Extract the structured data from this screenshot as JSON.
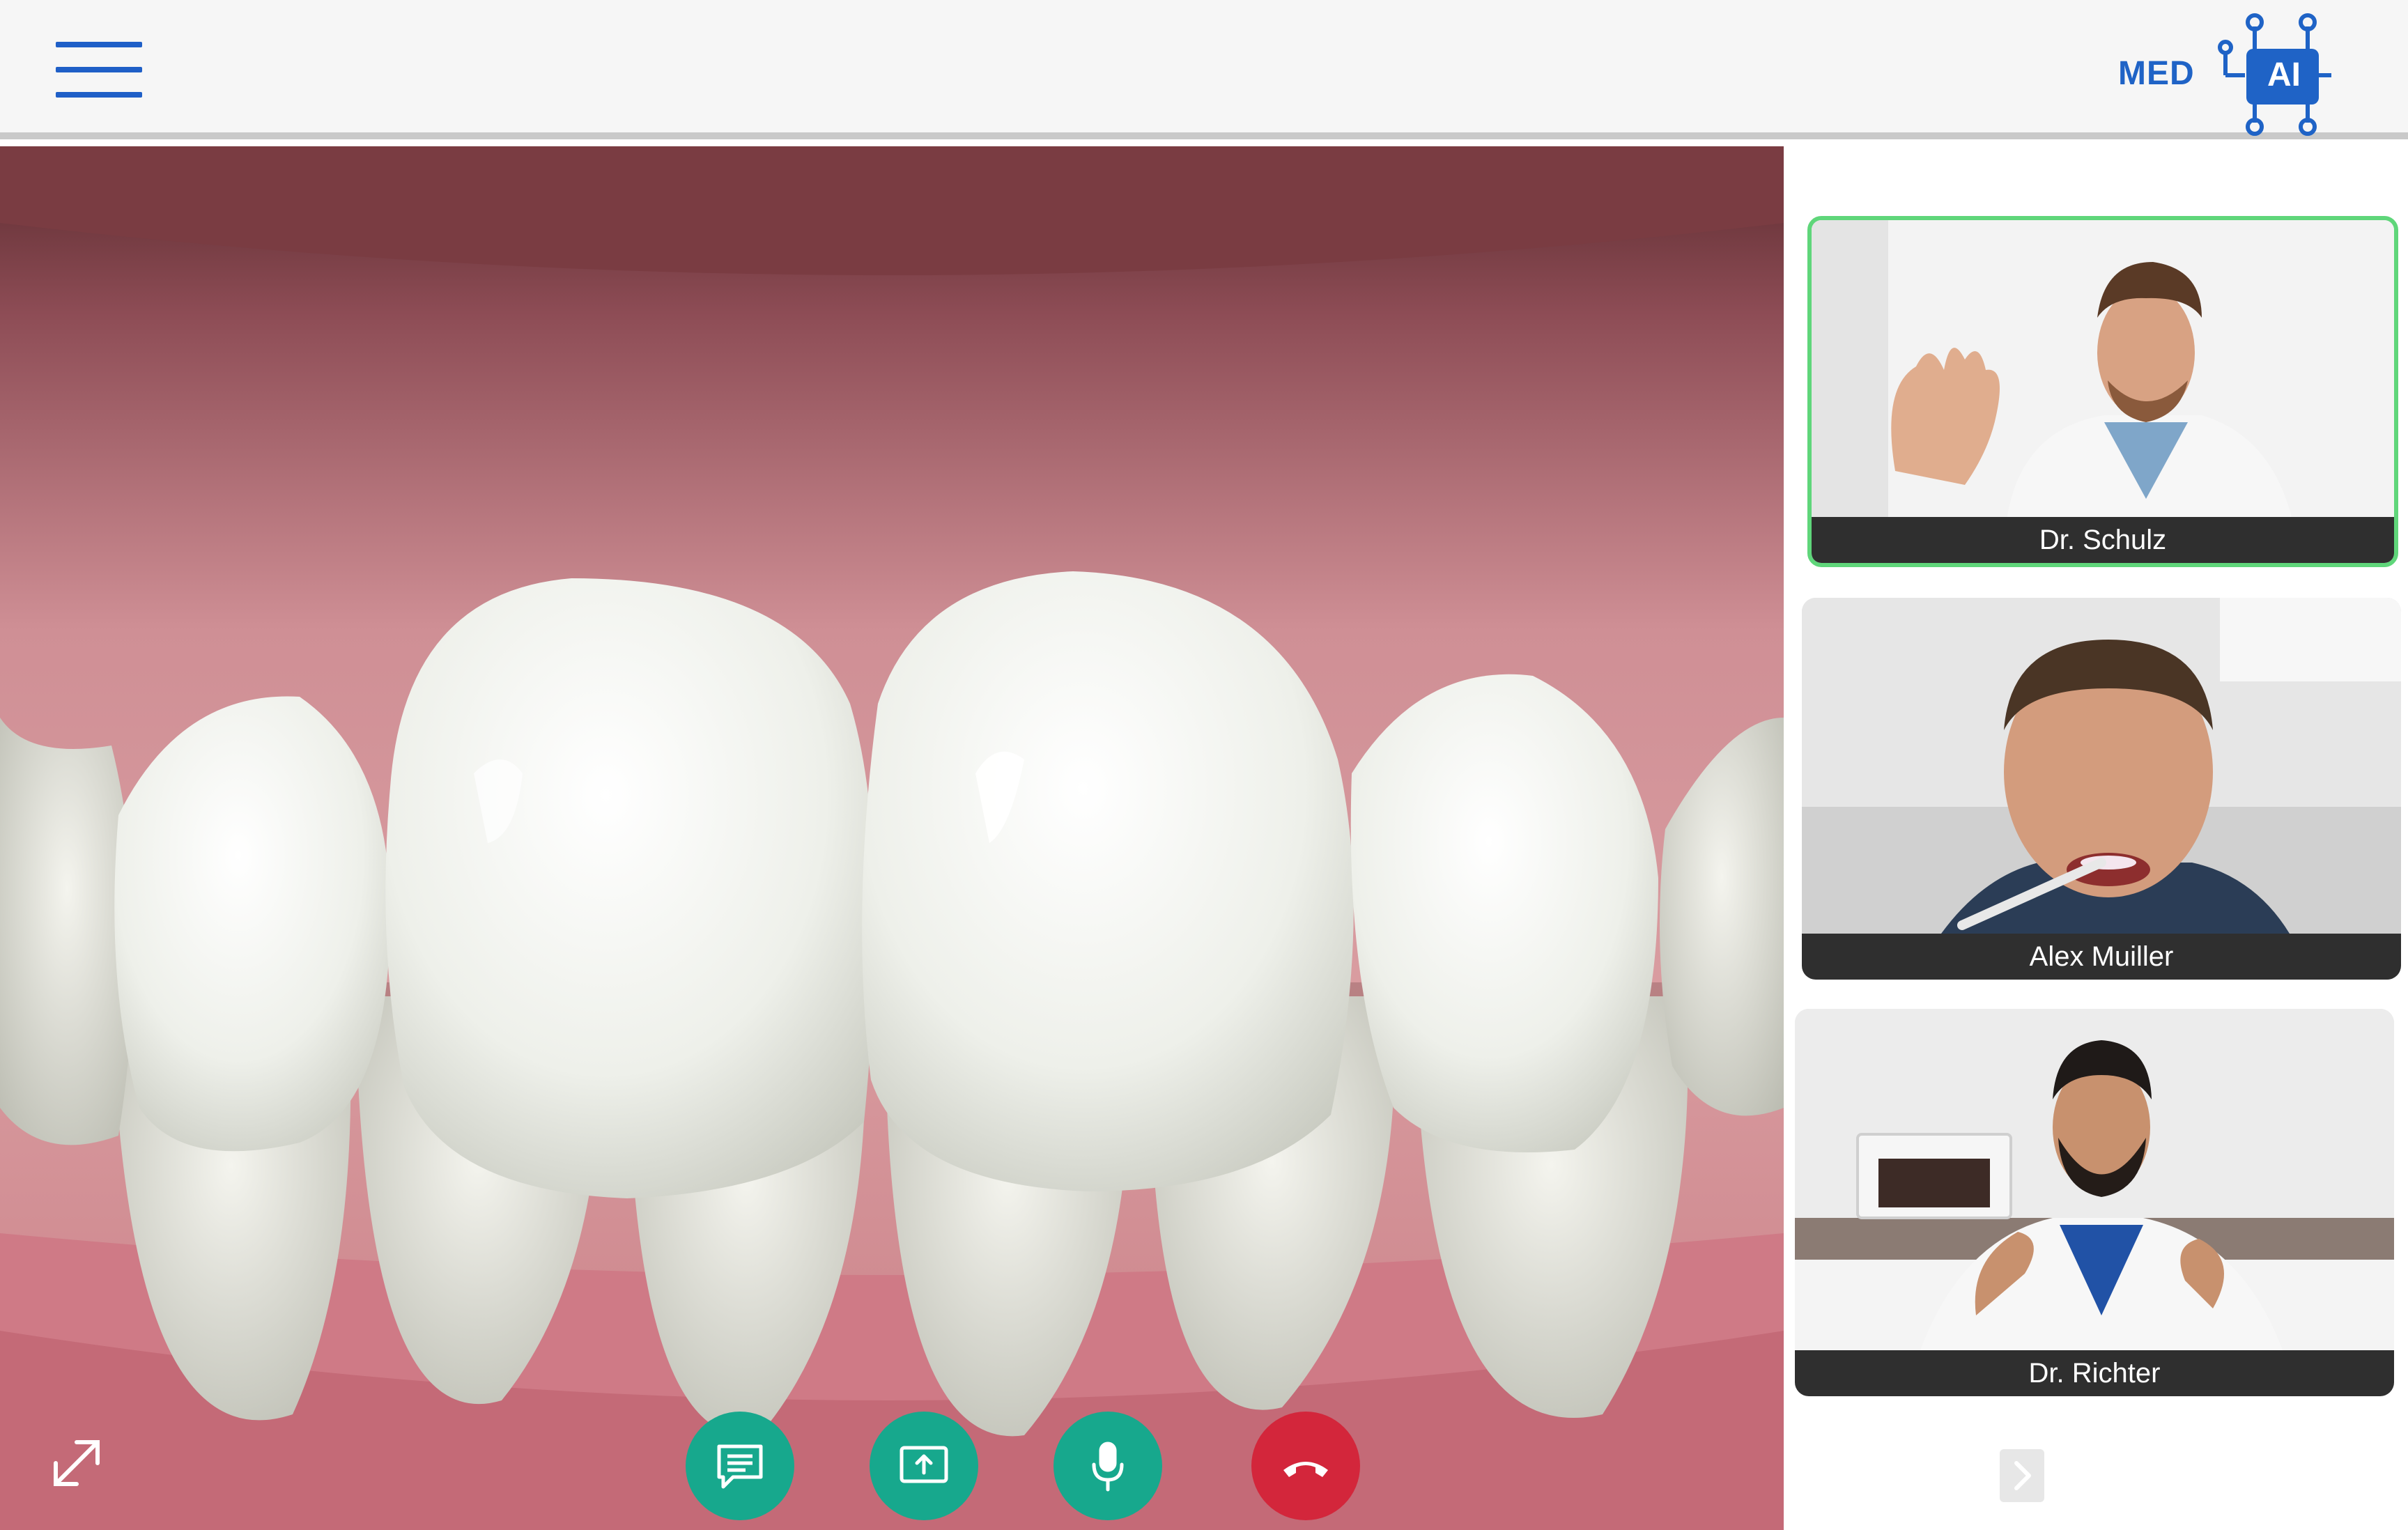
{
  "logo": {
    "text": "MED",
    "badge": "AI",
    "color": "#1f63c6"
  },
  "header": {
    "menu_icon": "hamburger-menu-icon"
  },
  "main_video": {
    "description_icon": "dental-closeup-image"
  },
  "controls": {
    "expand_icon": "expand-arrows-icon",
    "chat_icon": "chat-icon",
    "share_icon": "screen-share-icon",
    "mic_icon": "microphone-icon",
    "hangup_icon": "hang-up-icon",
    "accent": "#17a88d",
    "danger": "#d3263b"
  },
  "participants": [
    {
      "name": "Dr. Schulz",
      "active": true,
      "highlight": "#5fd67a"
    },
    {
      "name": "Alex Muiller",
      "active": false
    },
    {
      "name": "Dr. Richter",
      "active": false
    }
  ],
  "sidebar": {
    "next_icon": "chevron-right-icon"
  }
}
